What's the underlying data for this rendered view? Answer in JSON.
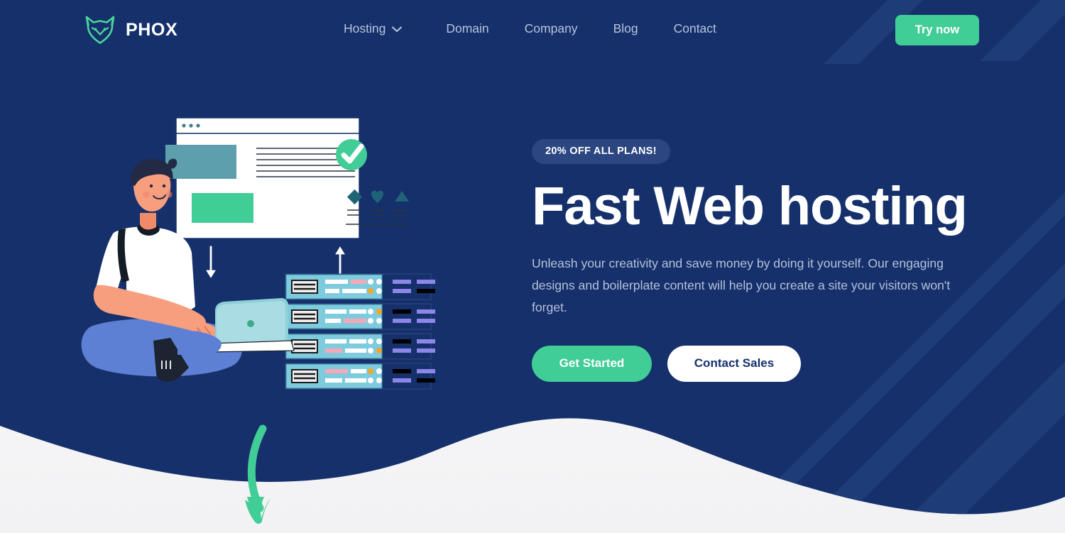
{
  "brand": {
    "name": "PHOX",
    "logo_icon": "fox-head-icon",
    "logo_color": "#4bd39c"
  },
  "nav": {
    "items": [
      {
        "label": "Hosting",
        "has_dropdown": true,
        "icon": "chevron-down-icon"
      },
      {
        "label": "Domain",
        "has_dropdown": false
      },
      {
        "label": "Company",
        "has_dropdown": false
      },
      {
        "label": "Blog",
        "has_dropdown": false
      },
      {
        "label": "Contact",
        "has_dropdown": false
      }
    ],
    "cta_label": "Try now"
  },
  "hero": {
    "badge": "20% OFF ALL PLANS!",
    "headline": "Fast Web hosting",
    "subcopy": "Unleash your creativity and save money by doing it yourself. Our engaging designs and boilerplate content will help you create a site your visitors won't forget.",
    "primary_cta": "Get Started",
    "secondary_cta": "Contact Sales"
  },
  "illustration": {
    "alt": "person-with-laptop-browser-window-and-servers",
    "browser_window": {
      "dots": 3,
      "check_badge_icon": "green-check-circle-icon",
      "shape_icons": [
        "diamond-icon",
        "heart-icon",
        "triangle-icon"
      ]
    },
    "arrows": [
      "arrow-down-icon",
      "arrow-up-icon",
      "curved-arrow-down-icon"
    ],
    "server_rows": 4
  },
  "colors": {
    "navy": "#15306b",
    "navy_stripe": "#1e3c77",
    "green": "#41cd96",
    "badge_bg": "#2b4680",
    "nav_text": "#b8c4dd",
    "body_text": "#b6c2da",
    "white": "#ffffff",
    "teal": "#5ea3b0",
    "light_teal": "#7ecbdd",
    "pink": "#f7a8b8",
    "orange": "#f5a623",
    "purple": "#8b86e8",
    "skin": "#f79e7e",
    "pants": "#5d7fd4"
  }
}
